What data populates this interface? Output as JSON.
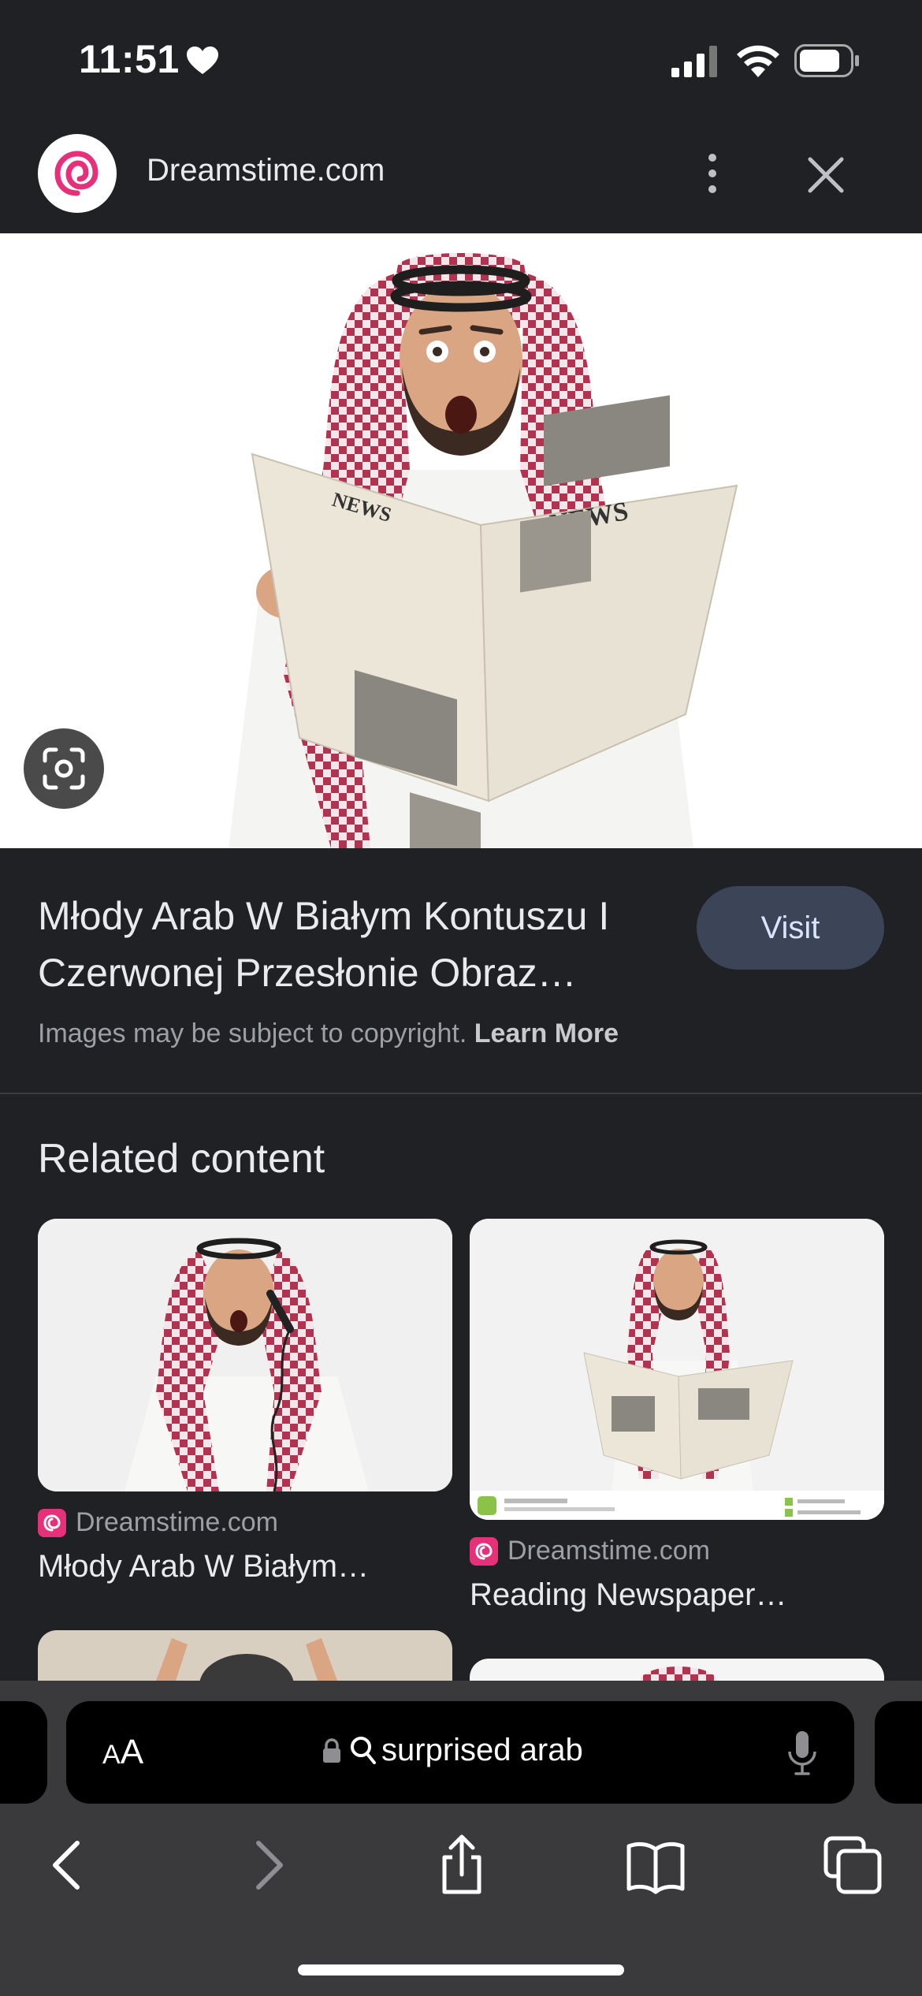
{
  "status": {
    "time": "11:51"
  },
  "header": {
    "site_name": "Dreamstime.com"
  },
  "result": {
    "title": "Młody Arab W Białym Kontuszu I Czerwonej Przesłonie Obraz…",
    "visit_label": "Visit",
    "copyright_text": "Images may be subject to copyright.",
    "learn_more": "Learn More"
  },
  "related": {
    "heading": "Related content",
    "cards": [
      {
        "source": "Dreamstime.com",
        "caption": "Młody Arab W Białym…"
      },
      {
        "source": "Dreamstime.com",
        "caption": "Reading Newspaper…"
      }
    ]
  },
  "toolbar": {
    "aa_label_small": "A",
    "aa_label_large": "A",
    "query": "surprised arab"
  },
  "colors": {
    "background": "#202124",
    "brand": "#e6317a",
    "visit_button": "#3c4458"
  },
  "icons": [
    "heart-icon",
    "signal-icon",
    "wifi-icon",
    "battery-icon",
    "more-vert-icon",
    "close-icon",
    "lens-icon",
    "lock-icon",
    "search-icon",
    "mic-icon",
    "back-icon",
    "forward-icon",
    "share-icon",
    "bookmarks-icon",
    "tabs-icon"
  ]
}
